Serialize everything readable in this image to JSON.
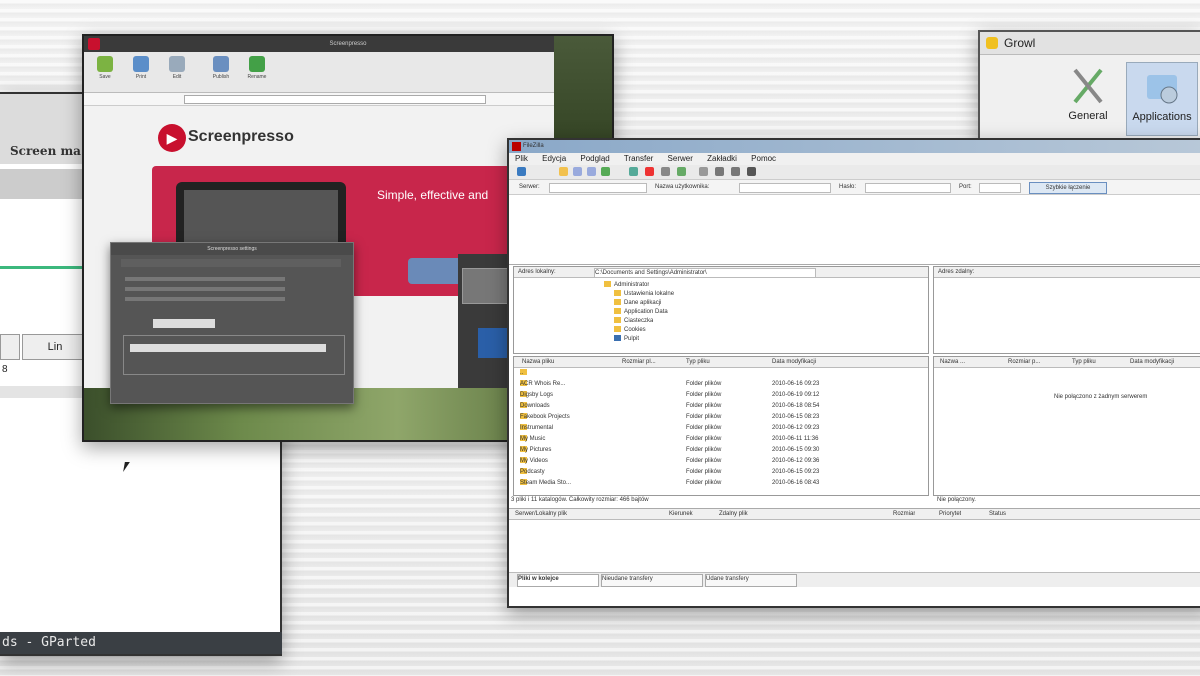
{
  "gparted": {
    "title_fragment": "Screen ma",
    "button_label": "Lin",
    "number": "8",
    "status_bar": "ds - GParted"
  },
  "screenpresso": {
    "window_title": "Screenpresso",
    "brand_name": "Screenpresso",
    "banner_heading": "Simple, effective and",
    "ribbon_buttons": [
      "Save",
      "Print",
      "Edit",
      "Publish",
      "Rename"
    ],
    "dialog_title": "Screenpresso settings"
  },
  "growl": {
    "title": "Growl",
    "items": [
      {
        "label": "General",
        "icon": "wrench-screwdriver-icon"
      },
      {
        "label": "Applications",
        "icon": "applications-icon"
      }
    ]
  },
  "filezilla": {
    "title": "FileZilla",
    "menu": [
      "Plik",
      "Edycja",
      "Podgląd",
      "Transfer",
      "Serwer",
      "Zakładki",
      "Pomoc"
    ],
    "quickconnect": {
      "labels": [
        "Serwer:",
        "Nazwa użytkownika:",
        "Hasło:",
        "Port:"
      ],
      "button": "Szybkie łączenie"
    },
    "local_site_label": "Adres lokalny:",
    "local_path": "C:\\Documents and Settings\\Administrator\\",
    "remote_site_label": "Adres zdalny:",
    "tree_items": [
      "Administrator",
      "Ustawienia lokalne",
      "Dane aplikacji",
      "Application Data",
      "Ciasteczka",
      "Cookies",
      "Pulpit"
    ],
    "file_columns": [
      "Nazwa pliku",
      "Rozmiar pl...",
      "Typ pliku",
      "Data modyfikacji"
    ],
    "remote_columns": [
      "Nazwa ...",
      "Rozmiar p...",
      "Typ pliku",
      "Data modyfikacji"
    ],
    "files": [
      {
        "name": "..",
        "size": "",
        "type": "",
        "date": ""
      },
      {
        "name": "ACR Whois Re...",
        "size": "",
        "type": "Folder plików",
        "date": "2010-06-16 09:23"
      },
      {
        "name": "Digsby Logs",
        "size": "",
        "type": "Folder plików",
        "date": "2010-06-19 09:12"
      },
      {
        "name": "Downloads",
        "size": "",
        "type": "Folder plików",
        "date": "2010-06-18 08:54"
      },
      {
        "name": "Fakebook Projects",
        "size": "",
        "type": "Folder plików",
        "date": "2010-06-15 08:23"
      },
      {
        "name": "Instrumental",
        "size": "",
        "type": "Folder plików",
        "date": "2010-06-12 09:23"
      },
      {
        "name": "My Music",
        "size": "",
        "type": "Folder plików",
        "date": "2010-06-11 11:36"
      },
      {
        "name": "My Pictures",
        "size": "",
        "type": "Folder plików",
        "date": "2010-06-15 09:30"
      },
      {
        "name": "My Videos",
        "size": "",
        "type": "Folder plików",
        "date": "2010-06-12 09:36"
      },
      {
        "name": "Podcasty",
        "size": "",
        "type": "Folder plików",
        "date": "2010-06-15 09:23"
      },
      {
        "name": "Steam Media Sto...",
        "size": "",
        "type": "Folder plików",
        "date": "2010-06-16 08:43"
      }
    ],
    "remote_empty_msg": "Nie połączono z żadnym serwerem",
    "local_status": "3 pliki i 11 katalogów. Całkowity rozmiar: 466 bajtów",
    "remote_status": "Nie połączony.",
    "queue_columns": [
      "Serwer/Lokalny plik",
      "Kierunek",
      "Zdalny plik",
      "Rozmiar",
      "Priorytet",
      "Status"
    ],
    "queue_tabs": [
      "Pliki w kolejce",
      "Nieudane transfery",
      "Udane transfery"
    ]
  }
}
